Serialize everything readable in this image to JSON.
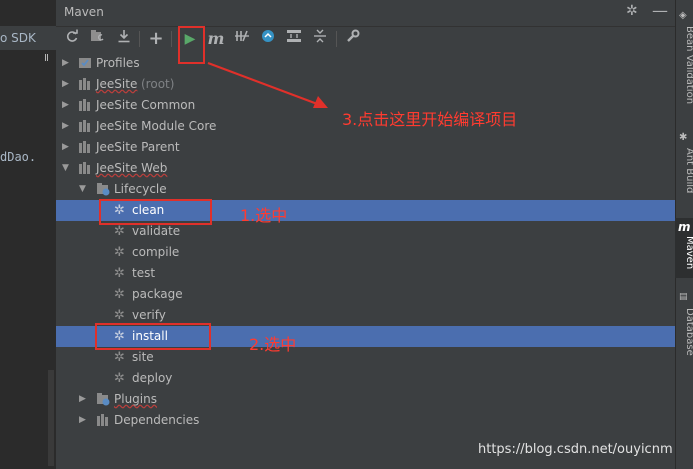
{
  "left": {
    "sdk_tab": "o SDK",
    "editor_text": "dDao.",
    "pause": "II"
  },
  "panel": {
    "title": "Maven"
  },
  "toolbar": {
    "refresh": "refresh-icon",
    "reimport": "reimport-icon",
    "download": "download-icon",
    "add": "+",
    "run": "▶",
    "execute_goal": "m",
    "toggle_offline": "offline-icon",
    "skip_tests": "skip-tests-icon",
    "show_deps": "dependencies-icon",
    "collapse": "collapse-icon",
    "settings": "wrench-icon"
  },
  "tree": {
    "profiles": "Profiles",
    "jeesite": "JeeSite",
    "jeesite_root": "(root)",
    "common": "JeeSite Common",
    "module_core": "JeeSite Module Core",
    "parent": "JeeSite Parent",
    "web": "JeeSite Web",
    "lifecycle": "Lifecycle",
    "phases": [
      "clean",
      "validate",
      "compile",
      "test",
      "package",
      "verify",
      "install",
      "site",
      "deploy"
    ],
    "plugins": "Plugins",
    "dependencies": "Dependencies"
  },
  "rightbar": {
    "bean_validation": "Bean Validation",
    "ant_build": "Ant Build",
    "maven": "Maven",
    "database": "Database"
  },
  "annotations": {
    "step1": "1.选中",
    "step2": "2.选中",
    "step3": "3.点击这里开始编译项目"
  },
  "watermark": "https://blog.csdn.net/ouyicnm",
  "colors": {
    "selection": "#4b6eaf",
    "run_green": "#59a869",
    "annotation_red": "#e0302a"
  }
}
